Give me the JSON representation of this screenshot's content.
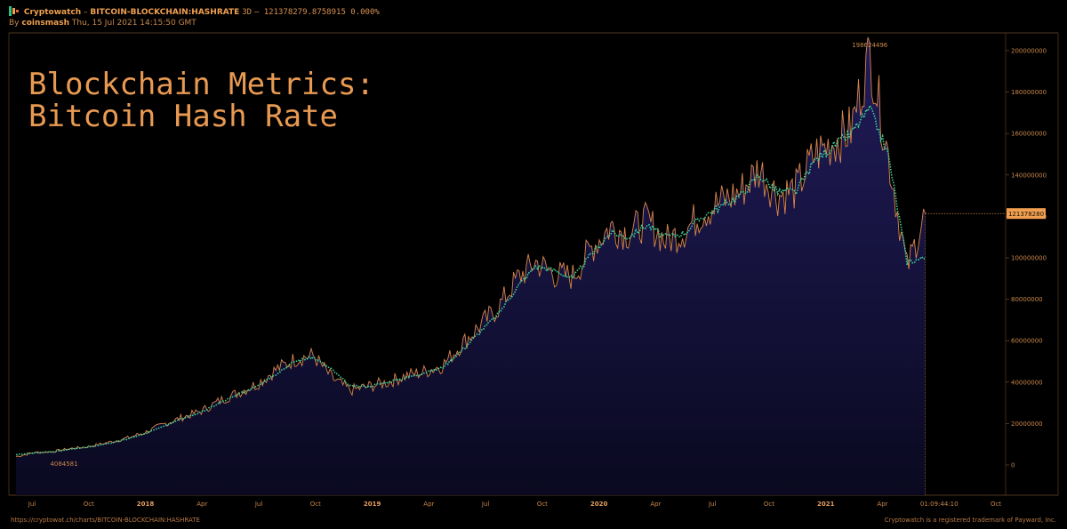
{
  "header": {
    "brand": "Cryptowatch",
    "separator": "–",
    "symbol": "BITCOIN-BLOCKCHAIN:HASHRATE",
    "interval": "3D",
    "price_line": "– 121378279.8758915 0.000%",
    "by_label": "By",
    "user": "coinsmash",
    "timestamp": "Thu, 15 Jul 2021 14:15:50 GMT"
  },
  "footer": {
    "url": "https://cryptowat.ch/charts/BITCOIN-BLOCKCHAIN:HASHRATE",
    "trademark": "Cryptowatch is a registered trademark of Payward, Inc."
  },
  "icons": [
    "cryptowatch-logo-icon"
  ],
  "colors": {
    "background": "#000000",
    "area_fill_top": "#1e1a52",
    "area_fill_bottom": "#0b0a20",
    "price_line": "#d9854a",
    "moving_average": "#3fcf9a",
    "accent": "#f0a050",
    "border": "#6b4a2a"
  },
  "chart_data": {
    "type": "area",
    "title": "Blockchain Metrics:\nBitcoin Hash Rate",
    "title_lines": [
      "Blockchain Metrics:",
      "Bitcoin Hash Rate"
    ],
    "x_tick_labels": [
      "Jul",
      "Oct",
      "2018",
      "Apr",
      "Jul",
      "Oct",
      "2019",
      "Apr",
      "Jul",
      "Oct",
      "2020",
      "Apr",
      "Jul",
      "Oct",
      "2021",
      "Apr",
      "01:09:44:10",
      "Oct"
    ],
    "y_tick_labels": [
      "200000000",
      "180000000",
      "160000000",
      "140000000",
      "120000000",
      "100000000",
      "80000000",
      "60000000",
      "40000000",
      "20000000",
      "0"
    ],
    "ylim": [
      0,
      200000000
    ],
    "xlim": [
      "2017-06-01",
      "2021-11-01"
    ],
    "annotations": {
      "max_label": "198624496",
      "min_label": "4084581",
      "last_value_label": "121378280",
      "last_value": 121378280
    },
    "series": [
      {
        "name": "Hash Rate",
        "x": [
          "2017-06-01",
          "2017-07-01",
          "2017-08-01",
          "2017-09-01",
          "2017-10-01",
          "2017-11-01",
          "2017-12-01",
          "2018-01-01",
          "2018-02-01",
          "2018-03-01",
          "2018-04-01",
          "2018-05-01",
          "2018-06-01",
          "2018-07-01",
          "2018-08-01",
          "2018-09-01",
          "2018-10-01",
          "2018-11-01",
          "2018-12-01",
          "2019-01-01",
          "2019-02-01",
          "2019-03-01",
          "2019-04-01",
          "2019-05-01",
          "2019-06-01",
          "2019-07-01",
          "2019-08-01",
          "2019-09-01",
          "2019-10-01",
          "2019-11-01",
          "2019-12-01",
          "2020-01-01",
          "2020-02-01",
          "2020-03-01",
          "2020-04-01",
          "2020-05-01",
          "2020-06-01",
          "2020-07-01",
          "2020-08-01",
          "2020-09-01",
          "2020-10-01",
          "2020-11-01",
          "2020-12-01",
          "2021-01-01",
          "2021-02-01",
          "2021-03-01",
          "2021-04-01",
          "2021-05-01",
          "2021-06-01",
          "2021-07-01"
        ],
        "values": [
          4084581,
          6000000,
          6500000,
          8000000,
          9000000,
          11000000,
          13000000,
          16000000,
          20000000,
          23000000,
          26000000,
          31000000,
          35000000,
          39000000,
          46000000,
          51000000,
          53000000,
          42000000,
          36000000,
          38000000,
          40000000,
          43000000,
          45000000,
          48000000,
          58000000,
          67000000,
          76000000,
          90000000,
          98000000,
          92000000,
          91000000,
          105000000,
          115000000,
          112000000,
          118000000,
          108000000,
          113000000,
          122000000,
          127000000,
          132000000,
          143000000,
          130000000,
          133000000,
          150000000,
          156000000,
          162000000,
          198624496,
          150000000,
          95000000,
          121378280
        ]
      },
      {
        "name": "Moving Average",
        "x": [
          "2017-06-01",
          "2017-07-01",
          "2017-08-01",
          "2017-09-01",
          "2017-10-01",
          "2017-11-01",
          "2017-12-01",
          "2018-01-01",
          "2018-02-01",
          "2018-03-01",
          "2018-04-01",
          "2018-05-01",
          "2018-06-01",
          "2018-07-01",
          "2018-08-01",
          "2018-09-01",
          "2018-10-01",
          "2018-11-01",
          "2018-12-01",
          "2019-01-01",
          "2019-02-01",
          "2019-03-01",
          "2019-04-01",
          "2019-05-01",
          "2019-06-01",
          "2019-07-01",
          "2019-08-01",
          "2019-09-01",
          "2019-10-01",
          "2019-11-01",
          "2019-12-01",
          "2020-01-01",
          "2020-02-01",
          "2020-03-01",
          "2020-04-01",
          "2020-05-01",
          "2020-06-01",
          "2020-07-01",
          "2020-08-01",
          "2020-09-01",
          "2020-10-01",
          "2020-11-01",
          "2020-12-01",
          "2021-01-01",
          "2021-02-01",
          "2021-03-01",
          "2021-04-01",
          "2021-05-01",
          "2021-06-01",
          "2021-07-01"
        ],
        "values": [
          5000000,
          5800000,
          6400000,
          7800000,
          8800000,
          10500000,
          12500000,
          15500000,
          19000000,
          22500000,
          25500000,
          30000000,
          34000000,
          38500000,
          44000000,
          50000000,
          52000000,
          46000000,
          38000000,
          38000000,
          40000000,
          42000000,
          44500000,
          47000000,
          55000000,
          64000000,
          73000000,
          86000000,
          96000000,
          94000000,
          90000000,
          102000000,
          112000000,
          110000000,
          116000000,
          110000000,
          112000000,
          120000000,
          125000000,
          130000000,
          140000000,
          132000000,
          132000000,
          147000000,
          154000000,
          160000000,
          172000000,
          150000000,
          98000000,
          100000000
        ]
      }
    ]
  }
}
